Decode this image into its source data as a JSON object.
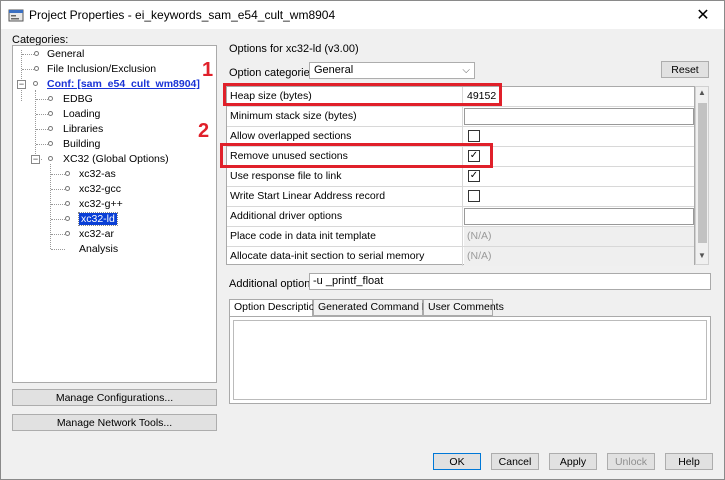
{
  "window": {
    "title": "Project Properties - ei_keywords_sam_e54_cult_wm8904",
    "close_glyph": "✕"
  },
  "left": {
    "categories_label": "Categories:",
    "tree": [
      {
        "label": "General"
      },
      {
        "label": "File Inclusion/Exclusion"
      },
      {
        "label": "Conf: [sam_e54_cult_wm8904]"
      },
      {
        "label": "EDBG"
      },
      {
        "label": "Loading"
      },
      {
        "label": "Libraries"
      },
      {
        "label": "Building"
      },
      {
        "label": "XC32 (Global Options)"
      },
      {
        "label": "xc32-as"
      },
      {
        "label": "xc32-gcc"
      },
      {
        "label": "xc32-g++"
      },
      {
        "label": "xc32-ld"
      },
      {
        "label": "xc32-ar"
      },
      {
        "label": "Analysis"
      }
    ],
    "manage_configurations": "Manage Configurations...",
    "manage_network_tools": "Manage Network Tools..."
  },
  "right": {
    "options_for": "Options for xc32-ld (v3.00)",
    "option_categories_label": "Option categories:",
    "option_category_value": "General",
    "reset": "Reset",
    "options": [
      {
        "name": "Heap size (bytes)",
        "value": "49152",
        "kind": "text"
      },
      {
        "name": "Minimum stack size (bytes)",
        "value": "",
        "kind": "text"
      },
      {
        "name": "Allow overlapped sections",
        "value": "",
        "kind": "checkbox",
        "checked": false
      },
      {
        "name": "Remove unused sections",
        "value": "",
        "kind": "checkbox",
        "checked": true
      },
      {
        "name": "Use response file to link",
        "value": "",
        "kind": "checkbox",
        "checked": true
      },
      {
        "name": "Write Start Linear Address record",
        "value": "",
        "kind": "checkbox",
        "checked": false
      },
      {
        "name": "Additional driver options",
        "value": "",
        "kind": "text"
      },
      {
        "name": "Place code in data init template",
        "value": "(N/A)",
        "kind": "na"
      },
      {
        "name": "Allocate data-init section to serial memory",
        "value": "(N/A)",
        "kind": "na"
      }
    ],
    "additional_options_label": "Additional options:",
    "additional_options_value": "-u _printf_float",
    "tabs": [
      "Option Description",
      "Generated Command Line",
      "User Comments"
    ]
  },
  "buttons": {
    "ok": "OK",
    "cancel": "Cancel",
    "apply": "Apply",
    "unlock": "Unlock",
    "help": "Help"
  },
  "annotations": {
    "one": "1",
    "two": "2",
    "color": "#e0202a"
  },
  "colors": {
    "selection": "#0a3fd6",
    "link": "#1a33d6"
  }
}
